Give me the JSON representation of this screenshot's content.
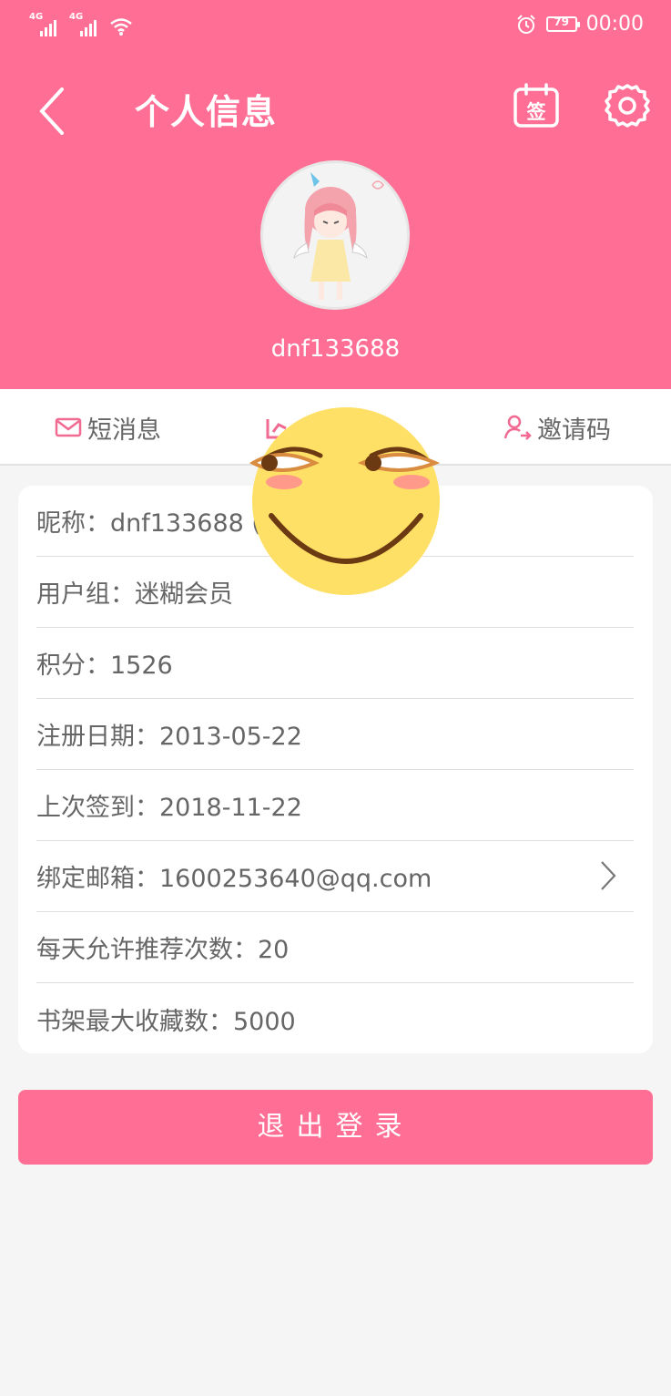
{
  "status_bar": {
    "signal_1_label": "4G",
    "signal_2_label": "4G",
    "battery_level": "79",
    "time": "00:00"
  },
  "header": {
    "title": "个人信息",
    "sign_button_label": "签",
    "username": "dnf133688",
    "background_color": "#ff6f95"
  },
  "tabs": [
    {
      "label": "短消息",
      "icon": "mail-icon"
    },
    {
      "label": "",
      "icon": "chart-icon"
    },
    {
      "label": "邀请码",
      "icon": "user-plus-icon"
    }
  ],
  "info": {
    "nickname": "昵称：dnf133688 (",
    "user_group": "用户组：迷糊会员",
    "points": "积分：1526",
    "register_date": "注册日期：2013-05-22",
    "last_signin": "上次签到：2018-11-22",
    "email": "绑定邮箱：1600253640@qq.com",
    "daily_recommend": "每天允许推荐次数：20",
    "bookshelf_max": "书架最大收藏数：5000"
  },
  "logout_label": "退出登录",
  "colors": {
    "accent": "#ff6f95",
    "emoji_face": "#ffe066"
  }
}
